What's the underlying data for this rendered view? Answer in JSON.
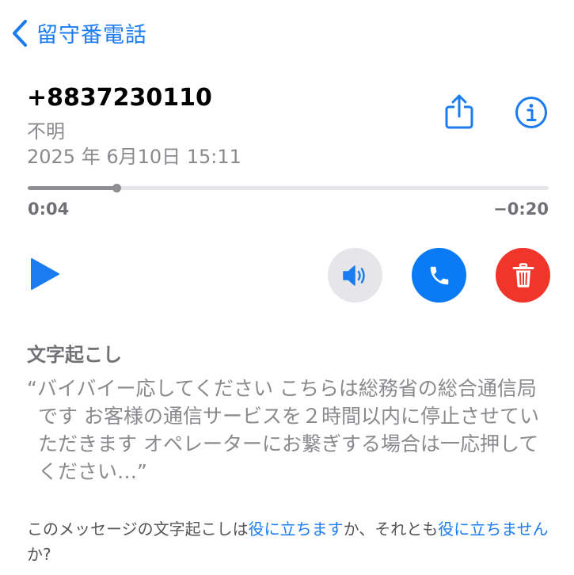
{
  "nav": {
    "back_label": "留守番電話"
  },
  "voicemail": {
    "phone_number": "+8837230110",
    "caller_label": "不明",
    "datetime": "2025 年 6月10日 15:11"
  },
  "player": {
    "elapsed": "0:04",
    "remaining": "−0:20",
    "progress": 0.17
  },
  "transcription": {
    "title": "文字起こし",
    "open_quote": "“",
    "text": "バイバイー応してください こちらは総務省の総合通信局です お客様の通信サービスを２時間以内に停止させていただきます オペレーターにお繋ぎする場合は一応押してください…",
    "close_quote": "”"
  },
  "feedback": {
    "prefix": "このメッセージの文字起こしは",
    "useful_link": "役に立ちます",
    "middle": "か、それとも",
    "not_useful_link": "役に立ちません",
    "suffix": "か?"
  },
  "colors": {
    "accent": "#1a7cf0",
    "call_button": "#0a7af5",
    "delete_button": "#f2352b",
    "speaker_button_bg": "#e5e5ea"
  },
  "icons": {
    "back": "chevron-left-icon",
    "share": "share-icon",
    "info": "info-icon",
    "play": "play-icon",
    "speaker": "speaker-icon",
    "call": "phone-icon",
    "delete": "trash-icon"
  }
}
